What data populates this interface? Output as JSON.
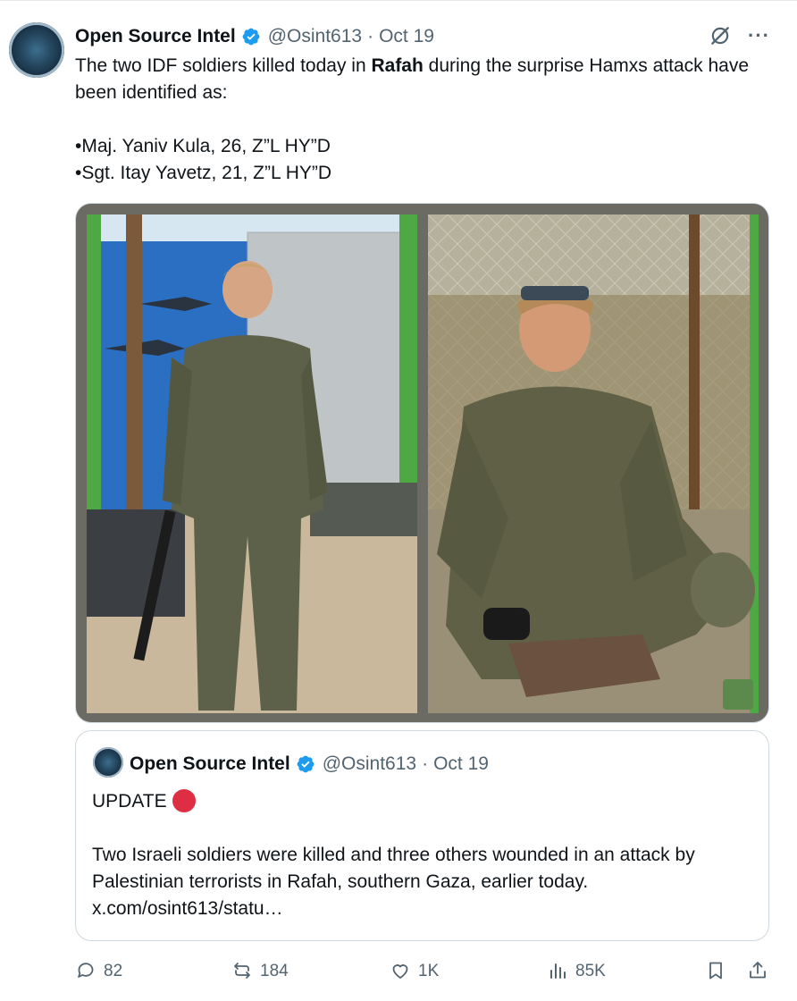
{
  "author": {
    "name": "Open Source Intel",
    "handle": "@Osint613",
    "separator": "·",
    "date": "Oct 19"
  },
  "tweet": {
    "line1_pre": "The two IDF soldiers killed today in ",
    "line1_bold": "Rafah",
    "line1_post": " during the surprise Hamxs attack have been identified as:",
    "item1": "•Maj. Yaniv Kula, 26, Z”L HY”D",
    "item2": "•Sgt. Itay Yavetz, 21, Z”L HY”D"
  },
  "quote": {
    "name": "Open Source Intel",
    "handle": "@Osint613",
    "separator": "·",
    "date": "Oct 19",
    "update_label": "UPDATE",
    "body": "Two Israeli soldiers were killed and three others wounded in an attack by Palestinian terrorists in Rafah, southern Gaza, earlier today.",
    "link": "x.com/osint613/statu…"
  },
  "actions": {
    "replies": "82",
    "reposts": "184",
    "likes": "1K",
    "views": "85K"
  },
  "icons": {
    "verified": "verified-badge-icon",
    "grok": "grok-icon",
    "more": "more-icon",
    "reply": "reply-icon",
    "repost": "repost-icon",
    "like": "heart-icon",
    "views": "views-icon",
    "bookmark": "bookmark-icon",
    "share": "share-icon"
  },
  "colors": {
    "text": "#0f1419",
    "secondary": "#536471",
    "verified": "#1d9bf0",
    "update_dot": "#dd2e44",
    "border": "#cfd9de"
  }
}
